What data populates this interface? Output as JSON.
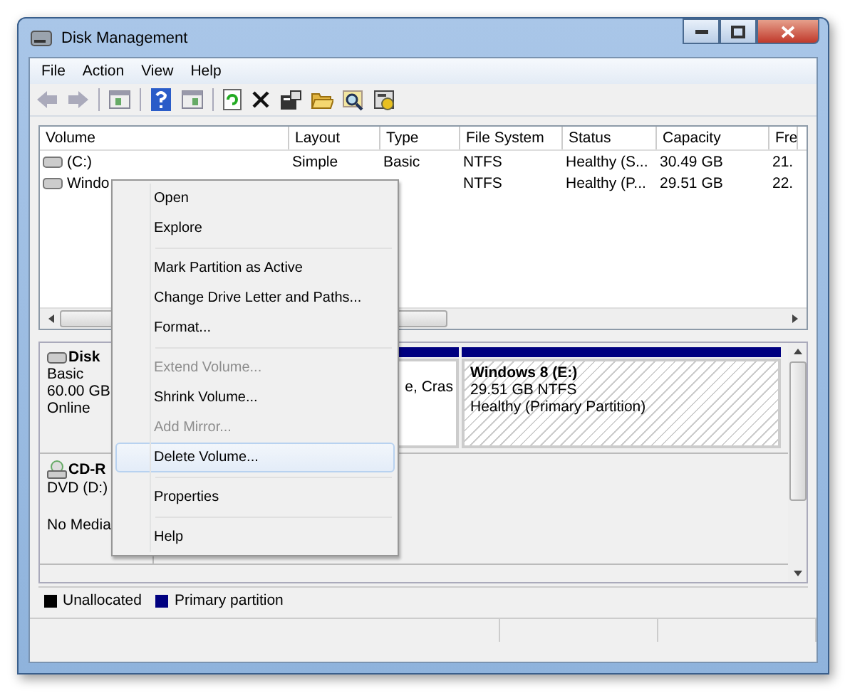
{
  "window": {
    "title": "Disk Management"
  },
  "menu_bar": [
    "File",
    "Action",
    "View",
    "Help"
  ],
  "volume_table": {
    "columns": [
      "Volume",
      "Layout",
      "Type",
      "File System",
      "Status",
      "Capacity",
      "Fre"
    ],
    "rows": [
      {
        "volume": "(C:)",
        "layout": "Simple",
        "type": "Basic",
        "file_system": "NTFS",
        "status": "Healthy (S...",
        "capacity": "30.49 GB",
        "free": "21."
      },
      {
        "volume": "Windo",
        "file_system": "NTFS",
        "status": "Healthy (P...",
        "capacity": "29.51 GB",
        "free": "22."
      }
    ]
  },
  "disks": [
    {
      "kind": "disk",
      "name": "Disk",
      "lines": [
        "Basic",
        "60.00 GB",
        "Online"
      ],
      "partitions": [
        {
          "lines": [
            "e, Cras"
          ],
          "hatched": false
        },
        {
          "title": "Windows 8  (E:)",
          "lines": [
            "29.51 GB NTFS",
            "Healthy (Primary Partition)"
          ],
          "hatched": true
        }
      ]
    },
    {
      "kind": "cdrom",
      "name": "CD-R",
      "lines": [
        "DVD (D:)",
        "No Media"
      ]
    }
  ],
  "legend": [
    {
      "label": "Unallocated",
      "color": "#000000"
    },
    {
      "label": "Primary partition",
      "color": "#000080"
    }
  ],
  "context_menu": [
    {
      "kind": "item",
      "label": "Open",
      "disabled": false,
      "selected": false
    },
    {
      "kind": "item",
      "label": "Explore",
      "disabled": false,
      "selected": false
    },
    {
      "kind": "separator"
    },
    {
      "kind": "item",
      "label": "Mark Partition as Active",
      "disabled": false,
      "selected": false
    },
    {
      "kind": "item",
      "label": "Change Drive Letter and Paths...",
      "disabled": false,
      "selected": false
    },
    {
      "kind": "item",
      "label": "Format...",
      "disabled": false,
      "selected": false
    },
    {
      "kind": "separator"
    },
    {
      "kind": "item",
      "label": "Extend Volume...",
      "disabled": true,
      "selected": false
    },
    {
      "kind": "item",
      "label": "Shrink Volume...",
      "disabled": false,
      "selected": false
    },
    {
      "kind": "item",
      "label": "Add Mirror...",
      "disabled": true,
      "selected": false
    },
    {
      "kind": "item",
      "label": "Delete Volume...",
      "disabled": false,
      "selected": true
    },
    {
      "kind": "separator"
    },
    {
      "kind": "item",
      "label": "Properties",
      "disabled": false,
      "selected": false
    },
    {
      "kind": "separator"
    },
    {
      "kind": "item",
      "label": "Help",
      "disabled": false,
      "selected": false
    }
  ]
}
